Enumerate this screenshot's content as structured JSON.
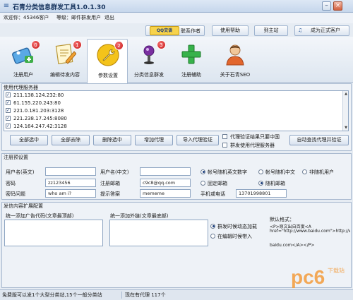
{
  "window": {
    "title": "石青分类信息群发工具1.0.1.30"
  },
  "infobar": {
    "welcome": "欢迎你：45346客户",
    "level": "等级：邮件群发用户",
    "logout": "退出"
  },
  "topbar": {
    "qq_label": "QQ交谈",
    "contact": "联系作者",
    "help": "使用帮助",
    "site": "到主站",
    "upgrade": "成为正式客户"
  },
  "tabs": [
    {
      "label": "注册用户",
      "badge": "0",
      "icon": "register-tag-icon"
    },
    {
      "label": "编辑待发内容",
      "badge": "1",
      "icon": "edit-paper-icon"
    },
    {
      "label": "参数设置",
      "badge": "2",
      "icon": "wrench-icon"
    },
    {
      "label": "分类信息群发",
      "badge": "3",
      "icon": "microphone-icon"
    },
    {
      "label": "注册辅助",
      "badge": "",
      "icon": "plus-icon"
    },
    {
      "label": "关于石青SEO",
      "badge": "",
      "icon": "person-icon"
    }
  ],
  "proxy": {
    "title": "使用代理服务器",
    "items": [
      "211.138.124.232:80",
      "61.155.220.243:80",
      "221.0.181.203:3128",
      "221.238.17.245:8080",
      "124.164.247.42:3128"
    ],
    "buttons": {
      "select_all": "全部选中",
      "deselect_all": "全部去除",
      "delete": "删除选中",
      "add": "增加代理",
      "import": "导入代理验证",
      "auto": "自动查找代理并验证"
    },
    "options": {
      "china_only": "代理验证结果只要中国",
      "group_use": "群发使用代理服务器"
    }
  },
  "register": {
    "title": "注册预设置",
    "username_en_label": "用户名(英文)",
    "username_en_value": "",
    "username_cn_label": "用户名(中文)",
    "username_cn_value": "",
    "password_label": "密码",
    "password_value": "zz123456",
    "email_label": "注册邮箱",
    "email_value": "c9c8@qq.com",
    "question_label": "密码问题",
    "question_value": "who am i?",
    "answer_label": "提示答案",
    "answer_value": "mememe",
    "phone_label": "手机或电话",
    "phone_value": "13701998801",
    "radio_row1": [
      "帐号随机英文数字",
      "帐号随机中文",
      "非随机用户"
    ],
    "radio_row2": [
      "固定邮箱",
      "随机邮箱"
    ]
  },
  "post": {
    "title": "发信内容扩展配置",
    "ad_label": "统一添加广告代码(文章最顶部)",
    "link_label": "统一添加外链(文章最底部)",
    "radio_auto": "群发时候动态加载",
    "radio_edit": "在编辑时候带入",
    "default_format_label": "默认格式：",
    "default_format_lines": [
      "<P>原文出自百度<A",
      "href=\"http://www.baidu.com\">http://w",
      "baidu.com</A></P>"
    ]
  },
  "status": {
    "left": "免费版可以发1个大型分类站,15个一般分类站",
    "right": "现在有代理 117个"
  },
  "watermark": {
    "text": "pc6",
    "sub": "下载站"
  },
  "colors": {
    "accent": "#2b5a9a",
    "badge": "#c51a1a",
    "watermark": "#f39c3c"
  }
}
